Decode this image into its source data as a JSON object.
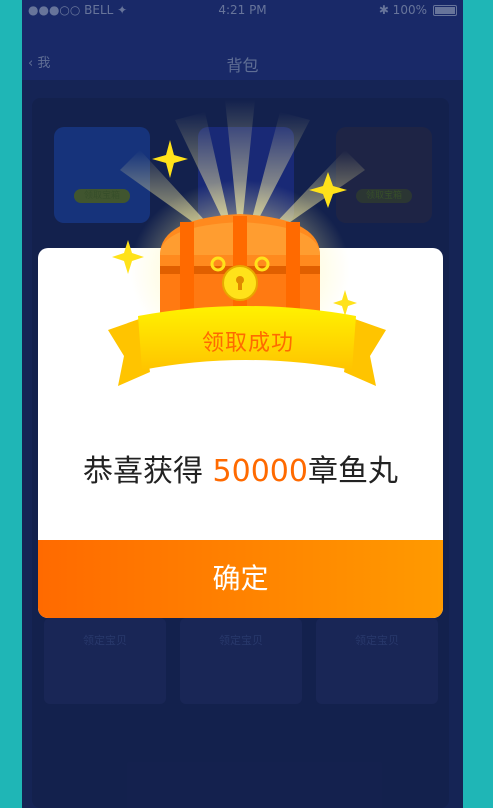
{
  "status_bar": {
    "carrier": "●●●○○ BELL ✦",
    "time": "4:21 PM",
    "battery": "✱ 100%"
  },
  "nav": {
    "back": "‹ 我",
    "title": "背包"
  },
  "background_cards": {
    "chests": [
      "领取宝箱",
      "",
      "领取宝箱"
    ],
    "bottom_labels": [
      "领定宝贝",
      "领定宝贝",
      "领定宝贝"
    ]
  },
  "modal": {
    "ribbon_text": "领取成功",
    "message_prefix": "恭喜获得 ",
    "amount": "50000",
    "message_suffix": "章鱼丸",
    "confirm_label": "确定"
  },
  "colors": {
    "accent": "#ff6a00",
    "page_bg": "#1fb6b6",
    "app_bg": "#1d2f6e"
  }
}
